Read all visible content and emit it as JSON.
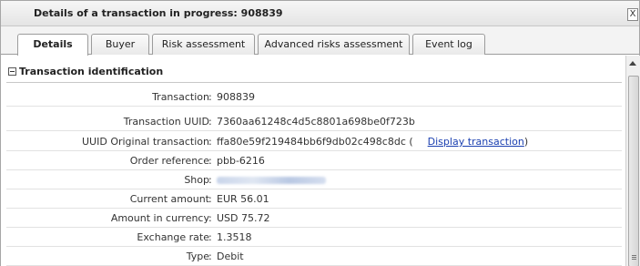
{
  "window": {
    "title": "Details of a transaction in progress: 908839",
    "close_glyph": "X"
  },
  "tabs": [
    {
      "label": "Details",
      "active": true
    },
    {
      "label": "Buyer",
      "active": false
    },
    {
      "label": "Risk assessment",
      "active": false
    },
    {
      "label": "Advanced risks assessment",
      "active": false
    },
    {
      "label": "Event log",
      "active": false
    }
  ],
  "section": {
    "title": "Transaction identification",
    "icon": "collapse-minus-icon"
  },
  "fields": [
    {
      "label": "Transaction",
      "value": "908839"
    },
    {
      "label": "Transaction UUID",
      "value": "7360aa61248c4d5c8801a698be0f723b"
    },
    {
      "label": "UUID Original transaction",
      "value": "ffa80e59f219484bb6f9db02c498c8dc (",
      "link": "Display transaction",
      "suffix": ")"
    },
    {
      "label": "Order reference",
      "value": "pbb-6216"
    },
    {
      "label": "Shop",
      "value": ""
    },
    {
      "label": "Current amount",
      "value": "EUR 56.01"
    },
    {
      "label": "Amount in currency",
      "value": "USD 75.72"
    },
    {
      "label": "Exchange rate",
      "value": "1.3518"
    },
    {
      "label": "Type",
      "value": "Debit"
    }
  ],
  "colon": ":",
  "colors": {
    "link": "#1a3fb0",
    "border": "#9c9c9c"
  }
}
